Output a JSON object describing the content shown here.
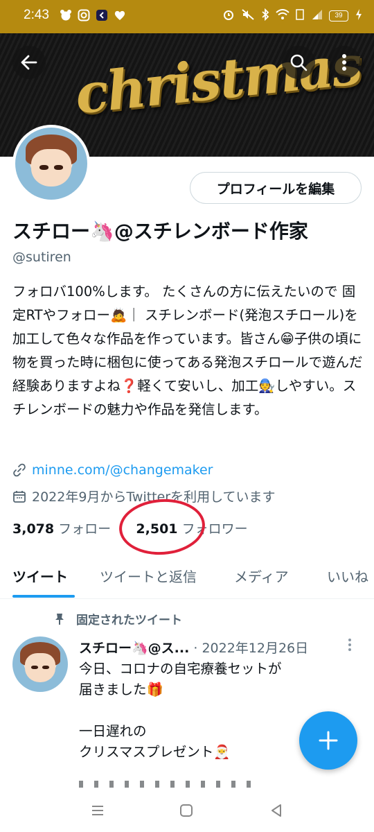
{
  "status_bar": {
    "time": "2:43",
    "battery": "39",
    "background_color": "#b58a10",
    "left_icons": [
      "bear-icon",
      "instagram-icon",
      "app-icon",
      "heart-icon"
    ],
    "right_icons": [
      "alarm-icon",
      "mute-icon",
      "bluetooth-icon",
      "wifi-icon",
      "volte-icon",
      "signal-icon",
      "battery-icon",
      "charging-icon"
    ]
  },
  "banner": {
    "word": "christmas",
    "text_color": "#d9b24a"
  },
  "profile": {
    "edit_button": "プロフィールを編集",
    "display_name": "スチロー🦄@スチレンボード作家",
    "handle": "@sutiren",
    "bio": "フォロバ100%します。 たくさんの方に伝えたいので 固定RTやフォロー🙇｜ スチレンボード(発泡スチロール)を加工して色々な作品を作っています。皆さん😁子供の頃に物を買った時に梱包に使ってある発泡スチロールで遊んだ経験ありますよね❓軽くて安いし、加工🧑‍🔧しやすい。スチレンボードの魅力や作品を発信します。",
    "link": "minne.com/@changemaker",
    "joined": "2022年9月からTwitterを利用しています",
    "following_count": "3,078",
    "following_label": "フォロー",
    "followers_count": "2,501",
    "followers_label": "フォロワー",
    "highlight_color": "#e0203a"
  },
  "tabs": [
    {
      "label": "ツイート",
      "active": true
    },
    {
      "label": "ツイートと返信",
      "active": false
    },
    {
      "label": "メディア",
      "active": false
    },
    {
      "label": "いいね",
      "active": false
    }
  ],
  "pinned_tweet": {
    "pinned_label": "固定されたツイート",
    "author": "スチロー🦄@ス...",
    "date": "· 2022年12月26日",
    "text": "今日、コロナの自宅療養セットが\n届きました🎁\n\n一日遅れの\nクリスマスプレゼント🎅"
  },
  "accent_color": "#1d9bf0"
}
